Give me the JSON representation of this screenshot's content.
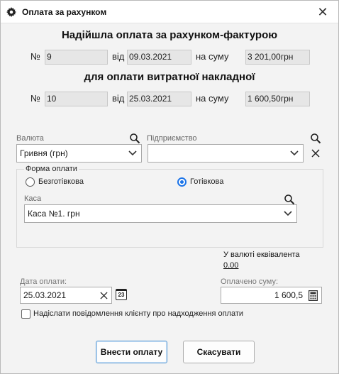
{
  "window": {
    "title": "Оплата за рахунком",
    "close_glyph": "✕"
  },
  "invoice": {
    "heading": "Надійшла оплата за рахунком-фактурою",
    "number_label": "№",
    "number": "9",
    "date_label": "від",
    "date": "09.03.2021",
    "sum_label": "на суму",
    "sum": "3 201,00грн"
  },
  "waybill": {
    "heading": "для оплати витратної накладної",
    "number_label": "№",
    "number": "10",
    "date_label": "від",
    "date": "25.03.2021",
    "sum_label": "на суму",
    "sum": "1 600,50грн"
  },
  "currency": {
    "label": "Валюта",
    "value": "Гривня (грн)"
  },
  "company": {
    "label": "Підприємство",
    "value": ""
  },
  "payment_form": {
    "label": "Форма оплати",
    "options": [
      "Безготівкова",
      "Готівкова"
    ],
    "selected_index": 1
  },
  "cashbox": {
    "label": "Каса",
    "value": "Каса №1. грн"
  },
  "equivalent": {
    "label": "У валюті еквівалента",
    "value": "0.00"
  },
  "payment_date": {
    "label": "Дата оплати:",
    "value": "25.03.2021",
    "calendar_day": "23"
  },
  "paid_sum": {
    "label": "Оплачено суму:",
    "value": "1 600,5"
  },
  "notify": {
    "label": "Надіслати повідомлення клієнту про надходження оплати",
    "checked": false
  },
  "buttons": {
    "submit": "Внести оплату",
    "cancel": "Скасувати"
  },
  "colors": {
    "accent": "#1a73e8",
    "readonly_bg": "#e6e6e6"
  }
}
